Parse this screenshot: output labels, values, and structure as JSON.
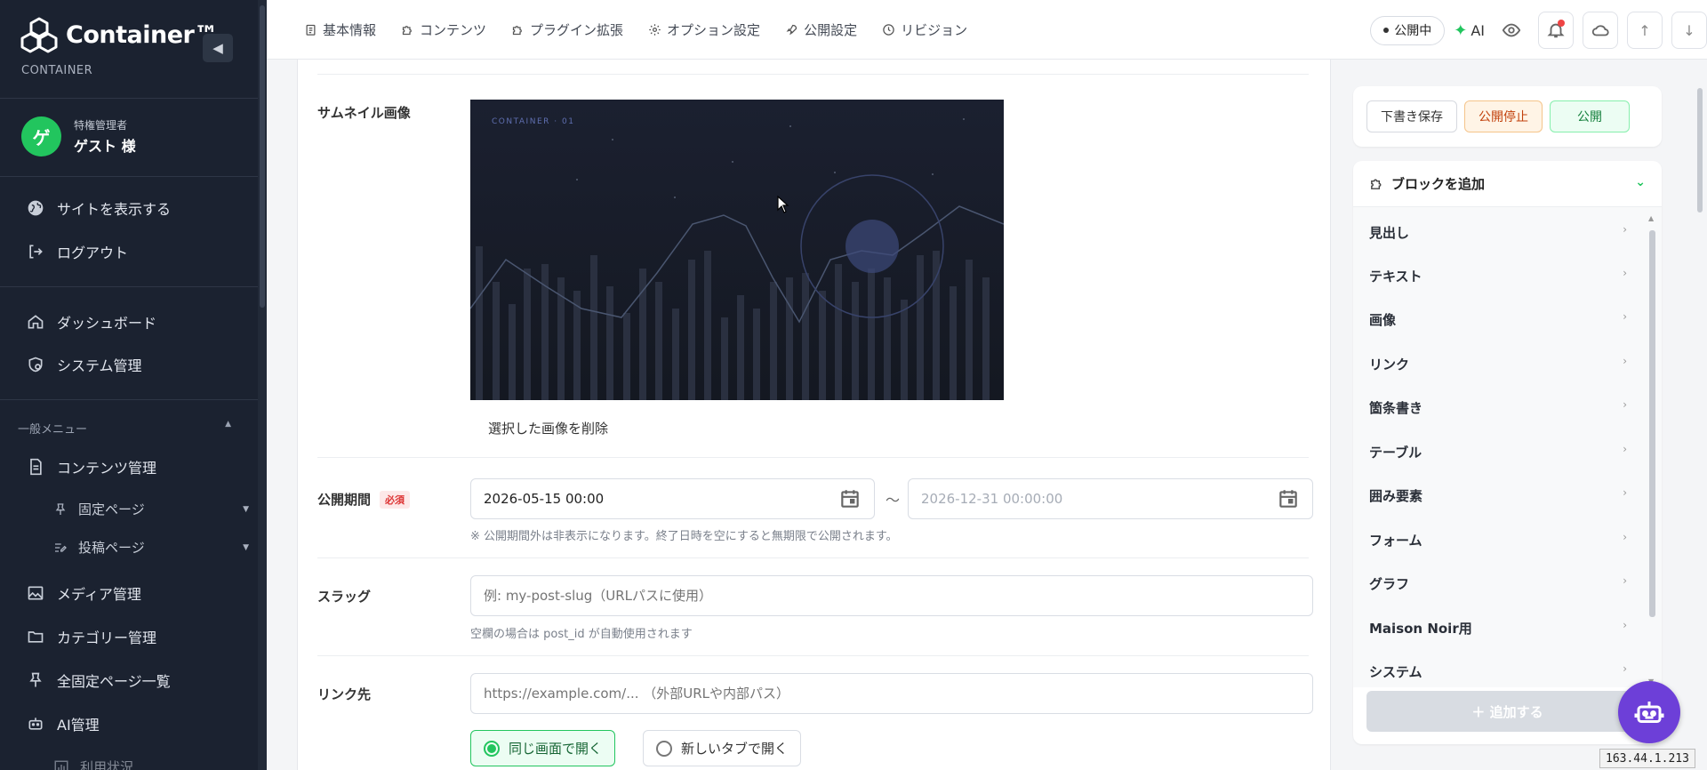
{
  "sidebar": {
    "logo_text": "Container™",
    "logo_sub": "CONTAINER",
    "user": {
      "avatar": "ゲ",
      "role": "特権管理者",
      "name": "ゲスト 様"
    },
    "top_links": [
      {
        "label": "サイトを表示する",
        "icon": "globe-icon"
      },
      {
        "label": "ログアウト",
        "icon": "logout-icon"
      }
    ],
    "main_links": [
      {
        "label": "ダッシュボード",
        "icon": "home-icon"
      },
      {
        "label": "システム管理",
        "icon": "shield-gear-icon"
      }
    ],
    "section_label": "一般メニュー",
    "menu": [
      {
        "label": "コンテンツ管理",
        "icon": "document-icon"
      },
      {
        "label": "固定ページ",
        "icon": "pin-icon"
      },
      {
        "label": "投稿ページ",
        "icon": "edit-list-icon"
      },
      {
        "label": "メディア管理",
        "icon": "image-icon"
      },
      {
        "label": "カテゴリー管理",
        "icon": "folder-icon"
      },
      {
        "label": "全固定ページ一覧",
        "icon": "pin-icon"
      },
      {
        "label": "AI管理",
        "icon": "robot-icon"
      },
      {
        "label": "利用状況",
        "icon": "chart-icon"
      }
    ]
  },
  "topbar": {
    "tabs": [
      {
        "label": "基本情報",
        "icon": "clipboard-icon"
      },
      {
        "label": "コンテンツ",
        "icon": "puzzle-icon"
      },
      {
        "label": "プラグイン拡張",
        "icon": "puzzle-icon"
      },
      {
        "label": "オプション設定",
        "icon": "gear-icon"
      },
      {
        "label": "公開設定",
        "icon": "rocket-icon"
      },
      {
        "label": "リビジョン",
        "icon": "clock-icon"
      }
    ],
    "status": "公開中",
    "ai_label": "AI",
    "icons": [
      "eye-icon",
      "bell-icon",
      "cloud-icon",
      "arrow-up-icon",
      "arrow-down-icon"
    ]
  },
  "form": {
    "thumbnail_label": "サムネイル画像",
    "thumbnail_caption": "CONTAINER · 01",
    "delete_image": "選択した画像を削除",
    "publish_period_label": "公開期間",
    "required_badge": "必須",
    "start_value": "2026-05-15 00:00",
    "end_placeholder": "2026-12-31 00:00:00",
    "range_sep": "〜",
    "period_help": "※ 公開期間外は非表示になります。終了日時を空にすると無期限で公開されます。",
    "slug_label": "スラッグ",
    "slug_placeholder": "例: my-post-slug（URLパスに使用）",
    "slug_help": "空欄の場合は post_id が自動使用されます",
    "link_label": "リンク先",
    "link_placeholder": "https://example.com/... （外部URLや内部パス）",
    "open_same": "同じ画面で開く",
    "open_new": "新しいタブで開く"
  },
  "actions": {
    "draft": "下書き保存",
    "unpublish": "公開停止",
    "publish": "公開"
  },
  "blocks": {
    "header": "ブロックを追加",
    "items": [
      "見出し",
      "テキスト",
      "画像",
      "リンク",
      "箇条書き",
      "テーブル",
      "囲み要素",
      "フォーム",
      "グラフ",
      "Maison Noir用",
      "システム"
    ],
    "add_button": "＋ 追加する"
  },
  "ip_address": "163.44.1.213",
  "colors": {
    "accent": "#22c55e",
    "sidebar_bg": "#1b2230",
    "bot": "#6d3fd8"
  }
}
